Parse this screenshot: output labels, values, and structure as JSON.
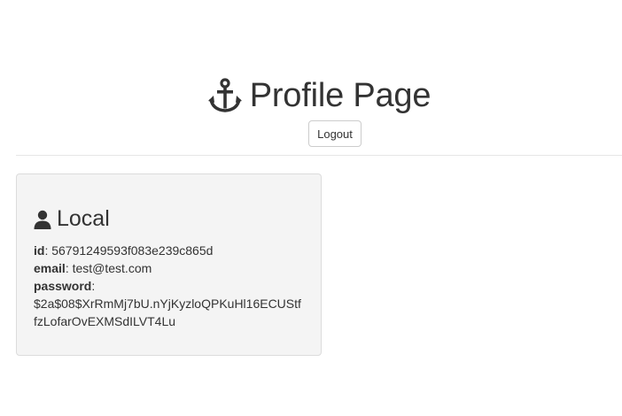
{
  "header": {
    "title": "Profile Page",
    "icon": "anchor-icon",
    "logout_label": "Logout"
  },
  "local": {
    "title": "Local",
    "icon": "user-icon",
    "fields": {
      "id_label": "id",
      "id_value": "56791249593f083e239c865d",
      "email_label": "email",
      "email_value": "test@test.com",
      "password_label": "password",
      "password_value_line1": "$2a$08$XrRmMj7bU.nYjKyzloQPKuHl16ECUStf",
      "password_value_line2": "fzLofarOvEXMSdILVT4Lu"
    }
  },
  "colors": {
    "text": "#333333",
    "card_bg": "#f4f4f4",
    "border": "#dcdcdc"
  }
}
